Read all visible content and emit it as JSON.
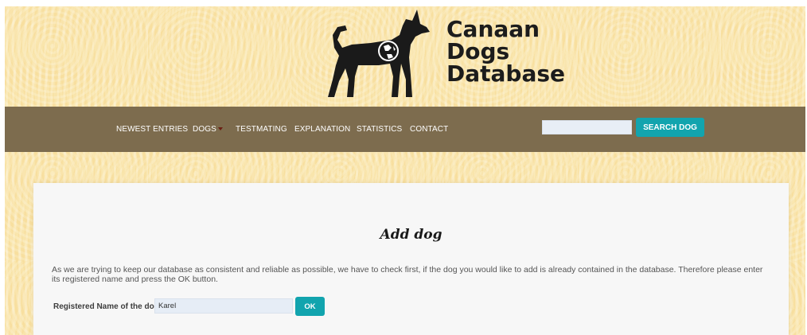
{
  "site": {
    "title_lines": [
      "Canaan",
      "Dogs",
      "Database"
    ],
    "logo_icon": "dog-silhouette-globe-icon"
  },
  "nav": {
    "items": [
      {
        "label": "NEWEST ENTRIES"
      },
      {
        "label": "DOGS",
        "has_dropdown": true
      },
      {
        "label": "TESTMATING"
      },
      {
        "label": "EXPLANATION"
      },
      {
        "label": "STATISTICS"
      },
      {
        "label": "CONTACT"
      }
    ],
    "search_value": "",
    "search_button_label": "SEARCH DOG"
  },
  "main": {
    "title": "Add dog",
    "instructions": "As we are trying to keep our database as consistent and reliable as possible, we have to check first, if the dog you would like to add is already contained in the database. Therefore please enter its registered name and press the OK button.",
    "form": {
      "label": "Registered Name of the dog:",
      "name_value": "Karel",
      "ok_label": "OK"
    }
  },
  "colors": {
    "navbar": "#7d6c4e",
    "accent": "#12a4ae",
    "background": "#f4d79f"
  }
}
